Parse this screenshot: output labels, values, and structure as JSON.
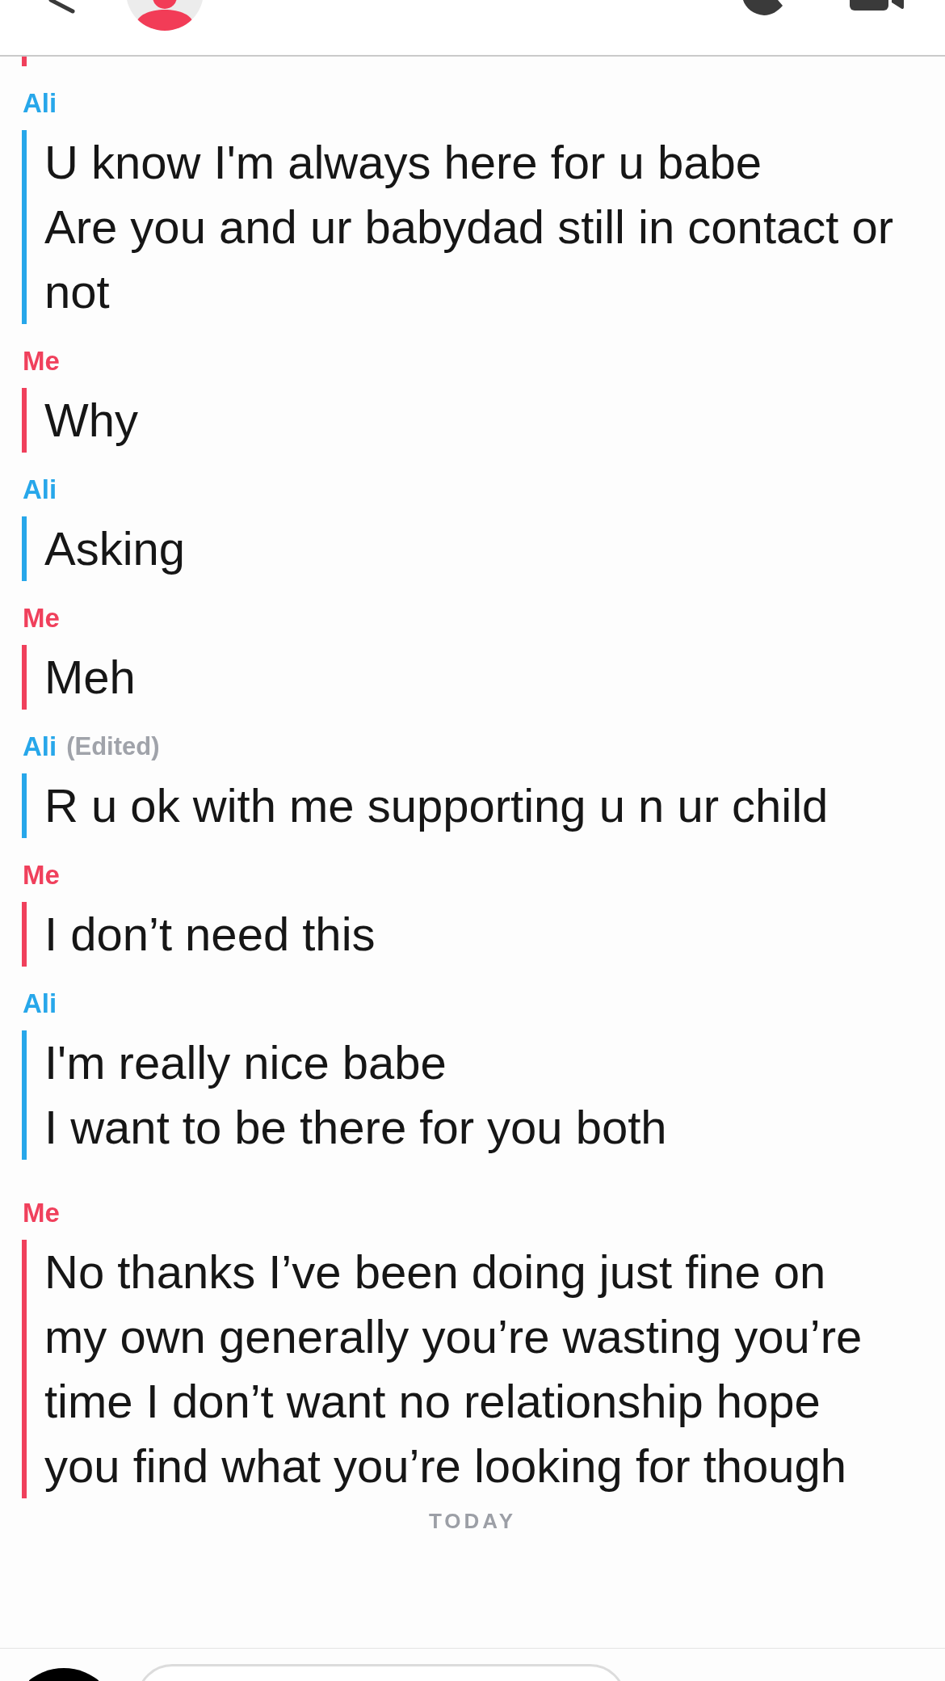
{
  "clipped_message": {
    "color": "#f0405c"
  },
  "messages": [
    {
      "sender": "Ali",
      "color": "#27a7ea",
      "lines": [
        "U know I'm always here for u babe",
        "Are you and ur babydad still in contact or not"
      ]
    },
    {
      "sender": "Me",
      "color": "#f0405c",
      "lines": [
        "Why"
      ]
    },
    {
      "sender": "Ali",
      "color": "#27a7ea",
      "lines": [
        "Asking"
      ]
    },
    {
      "sender": "Me",
      "color": "#f0405c",
      "lines": [
        "Meh"
      ]
    },
    {
      "sender": "Ali",
      "color": "#27a7ea",
      "note": "(Edited)",
      "lines": [
        "R u ok with me supporting u n ur child"
      ]
    },
    {
      "sender": "Me",
      "color": "#f0405c",
      "lines": [
        "I don’t need this"
      ]
    },
    {
      "sender": "Ali",
      "color": "#27a7ea",
      "lines": [
        "I'm really nice babe",
        "I want to be there for you both"
      ]
    },
    {
      "sender": "Me",
      "color": "#f0405c",
      "lines": [
        "No thanks I’ve been doing just fine on my own generally you’re wasting you’re time I don’t want no relationship hope you find what you’re looking for though"
      ]
    }
  ],
  "date_divider": "TODAY"
}
